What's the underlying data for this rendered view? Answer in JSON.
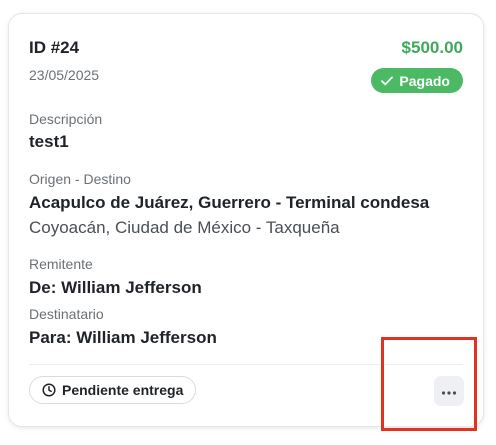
{
  "card": {
    "id_text": "ID #24",
    "amount": "$500.00",
    "date": "23/05/2025",
    "payment_status": "Pagado",
    "description_label": "Descripción",
    "description_value": "test1",
    "route_label": "Origen - Destino",
    "route_origin": "Acapulco de Juárez, Guerrero - Terminal condesa",
    "route_destination": "Coyoacán, Ciudad de México - Taxqueña",
    "sender_label": "Remitente",
    "sender_value": "De: William Jefferson",
    "recipient_label": "Destinatario",
    "recipient_value": "Para: William Jefferson",
    "delivery_status": "Pendiente entrega",
    "more_icon": "ellipsis-icon"
  },
  "colors": {
    "amount_green": "#3fa95b",
    "badge_green": "#4cb964",
    "highlight_red": "#e2321e"
  }
}
